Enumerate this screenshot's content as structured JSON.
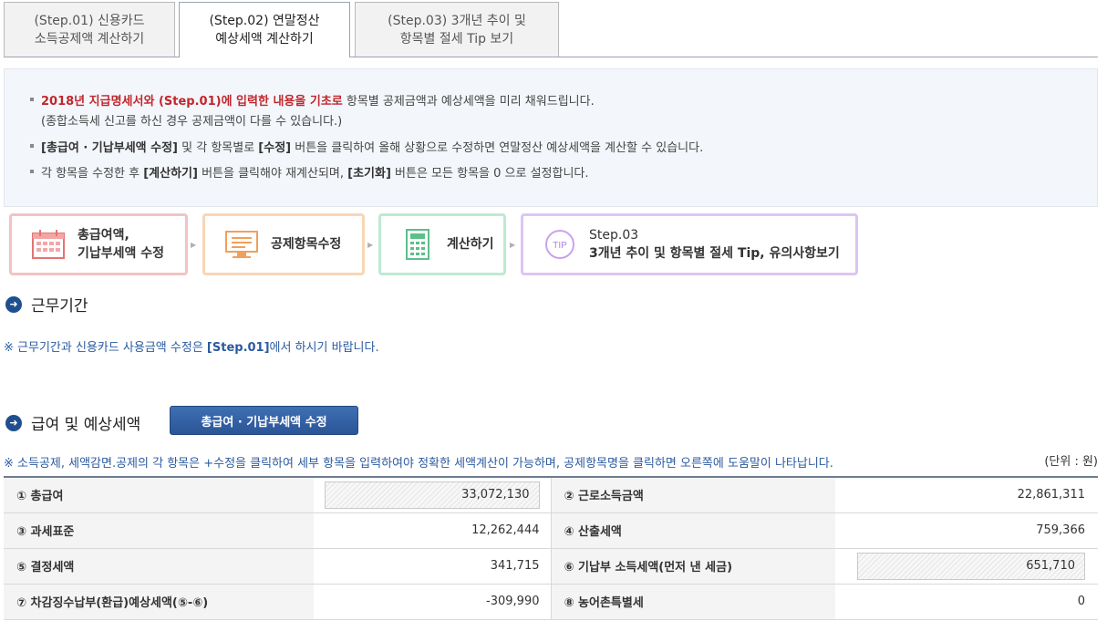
{
  "tabs": [
    {
      "step": "(Step.01)",
      "title": "신용카드",
      "title2": "소득공제액 계산하기"
    },
    {
      "step": "(Step.02)",
      "title": "연말정산",
      "title2": "예상세액 계산하기"
    },
    {
      "step": "(Step.03)",
      "title": "3개년 추이 및",
      "title2": "항목별 절세 Tip 보기"
    }
  ],
  "info": {
    "line1_red": "2018년 지급명세서와 (Step.01)에 입력한 내용을 기초로",
    "line1_rest": " 항목별 공제금액과 예상세액을 미리 채워드립니다.",
    "line1b": "(종합소득세 신고를 하신 경우 공제금액이 다를 수 있습니다.)",
    "line2_b1": "[총급여 · 기납부세액 수정]",
    "line2_t1": " 및 각 항목별로 ",
    "line2_b2": "[수정]",
    "line2_t2": " 버튼을 클릭하여 올해 상황으로 수정하면 연말정산 예상세액을 계산할 수 있습니다.",
    "line3_t1": "각 항목을 수정한 후 ",
    "line3_b1": "[계산하기]",
    "line3_t2": " 버튼을 클릭해야 재계산되며, ",
    "line3_b2": "[초기화]",
    "line3_t3": " 버튼은 모든 항목을 0 으로 설정합니다."
  },
  "steps": [
    {
      "line1": "총급여액,",
      "line2": "기납부세액 수정",
      "color": "#f0b6b6"
    },
    {
      "line1": "공제항목수정",
      "line2": "",
      "color": "#f7d2ae"
    },
    {
      "line1": "계산하기",
      "line2": "",
      "color": "#b9e6cc"
    },
    {
      "line1": "Step.03",
      "line2": "3개년 추이 및 항목별 절세 Tip, 유의사항보기",
      "color": "#d9bff0"
    }
  ],
  "section1": {
    "title": "근무기간",
    "note_pre": "※ 근무기간과 신용카드 사용금액 수정은 ",
    "note_bold": "[Step.01]",
    "note_post": "에서 하시기 바랍니다."
  },
  "section2": {
    "title": "급여 및 예상세액",
    "button": "총급여 · 기납부세액 수정",
    "note": "※ 소득공제, 세액감면.공제의 각 항목은 +수정을 클릭하여 세부 항목을 입력하여야 정확한 세액계산이 가능하며, 공제항목명을 클릭하면 오른쪽에 도움말이 나타납니다.",
    "unit": "(단위 : 원)"
  },
  "table": {
    "rows": [
      {
        "l1": "① 총급여",
        "v1": "33,072,130",
        "l2": "② 근로소득금액",
        "v2": "22,861,311"
      },
      {
        "l1": "③ 과세표준",
        "v1": "12,262,444",
        "l2": "④ 산출세액",
        "v2": "759,366"
      },
      {
        "l1": "⑤ 결정세액",
        "v1": "341,715",
        "l2": "⑥ 기납부 소득세액(먼저 낸 세금)",
        "v2": "651,710"
      },
      {
        "l1": "⑦ 차감징수납부(환급)예상세액(⑤-⑥)",
        "v1": "-309,990",
        "l2": "⑧ 농어촌특별세",
        "v2": "0"
      }
    ]
  },
  "icons": {
    "step1": "calendar-icon",
    "step2": "monitor-icon",
    "step3": "calculator-icon",
    "step4": "tip-icon"
  }
}
